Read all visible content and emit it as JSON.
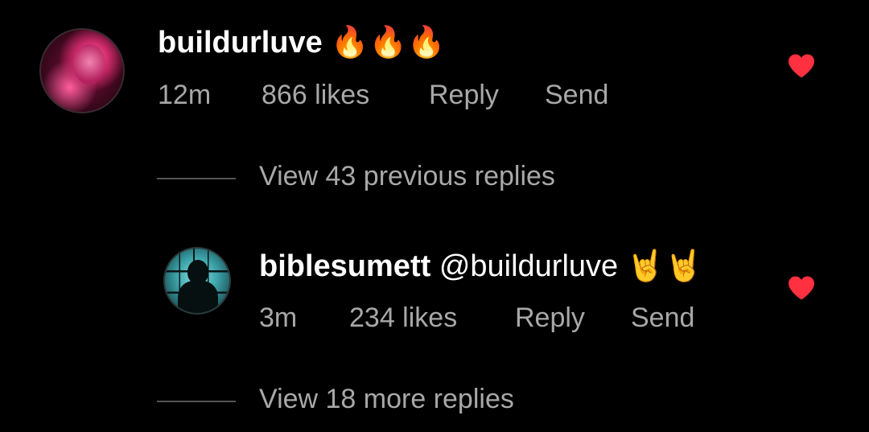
{
  "comment": {
    "username": "buildurluve",
    "text": "🔥🔥🔥",
    "time": "12m",
    "likes": "866 likes",
    "reply_label": "Reply",
    "send_label": "Send",
    "liked": true
  },
  "view_previous": {
    "label": "View 43 previous replies"
  },
  "reply": {
    "username": "biblesumett",
    "mention": "@buildurluve",
    "text": "🤘🤘",
    "time": "3m",
    "likes": "234 likes",
    "reply_label": "Reply",
    "send_label": "Send",
    "liked": true
  },
  "view_more": {
    "label": "View 18 more replies"
  },
  "colors": {
    "background": "#000000",
    "primary_text": "#ffffff",
    "secondary_text": "#a8a8a8",
    "heart": "#ff3040",
    "divider": "#555555"
  },
  "icons": {
    "heart": "heart-icon"
  }
}
